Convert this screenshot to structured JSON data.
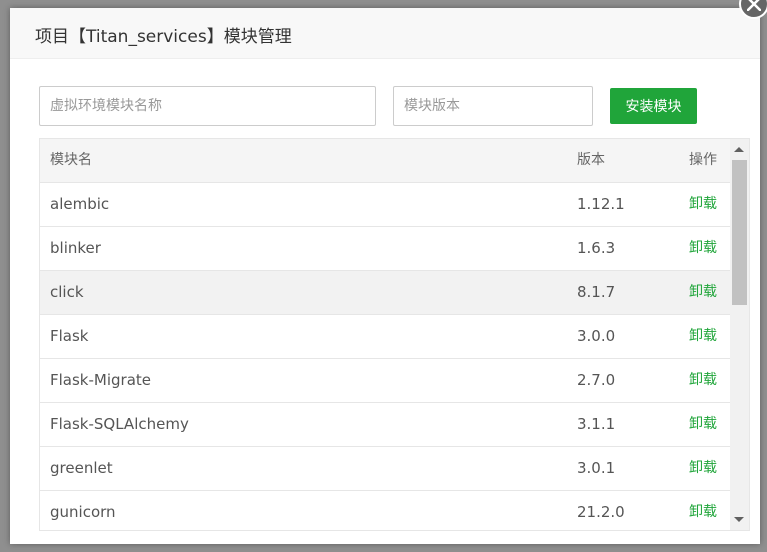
{
  "dialog": {
    "title": "项目【Titan_services】模块管理"
  },
  "form": {
    "module_name_placeholder": "虚拟环境模块名称",
    "module_version_placeholder": "模块版本",
    "install_label": "安装模块"
  },
  "table": {
    "headers": {
      "name": "模块名",
      "version": "版本",
      "action": "操作"
    },
    "rows": [
      {
        "name": "alembic",
        "version": "1.12.1",
        "action": "卸载"
      },
      {
        "name": "blinker",
        "version": "1.6.3",
        "action": "卸载"
      },
      {
        "name": "click",
        "version": "8.1.7",
        "action": "卸载"
      },
      {
        "name": "Flask",
        "version": "3.0.0",
        "action": "卸载"
      },
      {
        "name": "Flask-Migrate",
        "version": "2.7.0",
        "action": "卸载"
      },
      {
        "name": "Flask-SQLAlchemy",
        "version": "3.1.1",
        "action": "卸载"
      },
      {
        "name": "greenlet",
        "version": "3.0.1",
        "action": "卸载"
      },
      {
        "name": "gunicorn",
        "version": "21.2.0",
        "action": "卸载"
      }
    ]
  },
  "colors": {
    "accent": "#20a53a",
    "header_bg": "#f8f8f8",
    "highlight_row": "#f2f2f2"
  },
  "icons": {
    "close": "close-icon",
    "scroll_up": "scroll-up-arrow",
    "scroll_down": "scroll-down-arrow"
  }
}
